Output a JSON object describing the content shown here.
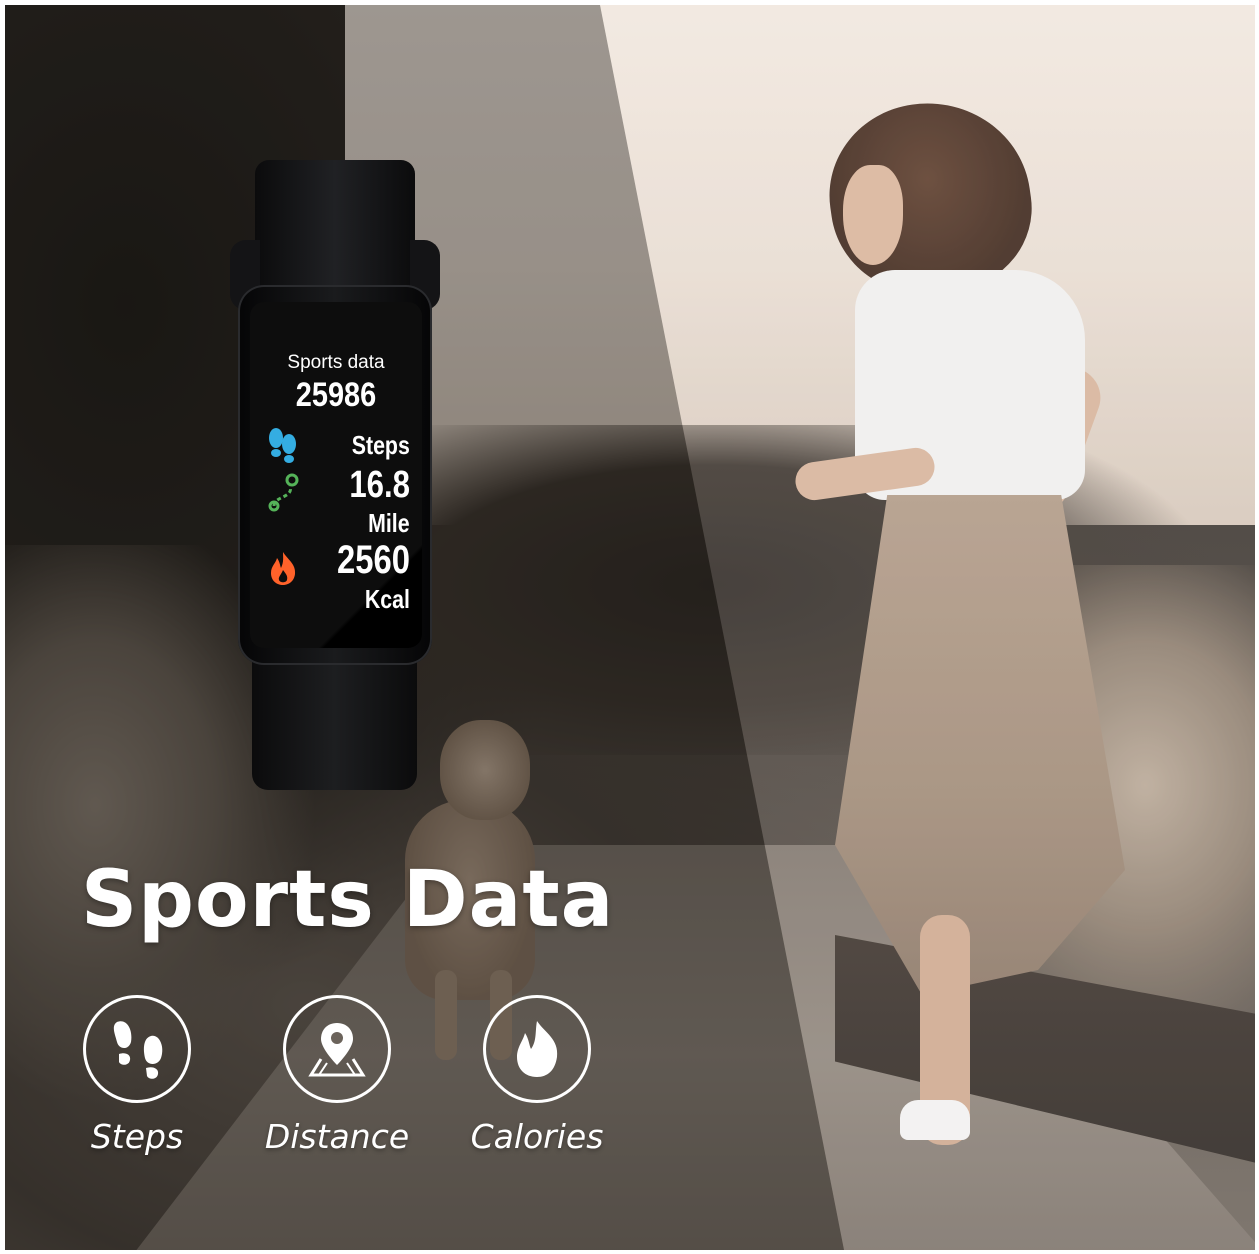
{
  "watch_screen": {
    "title": "Sports data",
    "steps_value": "25986",
    "steps_label": "Steps",
    "distance_value": "16.8",
    "distance_label": "Mile",
    "calories_value": "2560",
    "calories_label": "Kcal"
  },
  "headline": "Sports Data",
  "features": [
    {
      "icon": "footprints-icon",
      "label": "Steps"
    },
    {
      "icon": "location-pin-icon",
      "label": "Distance"
    },
    {
      "icon": "flame-icon",
      "label": "Calories"
    }
  ],
  "colors": {
    "steps_icon": "#29a9e0",
    "distance_icon": "#4caf50",
    "calories_icon": "#ff5a1f"
  }
}
